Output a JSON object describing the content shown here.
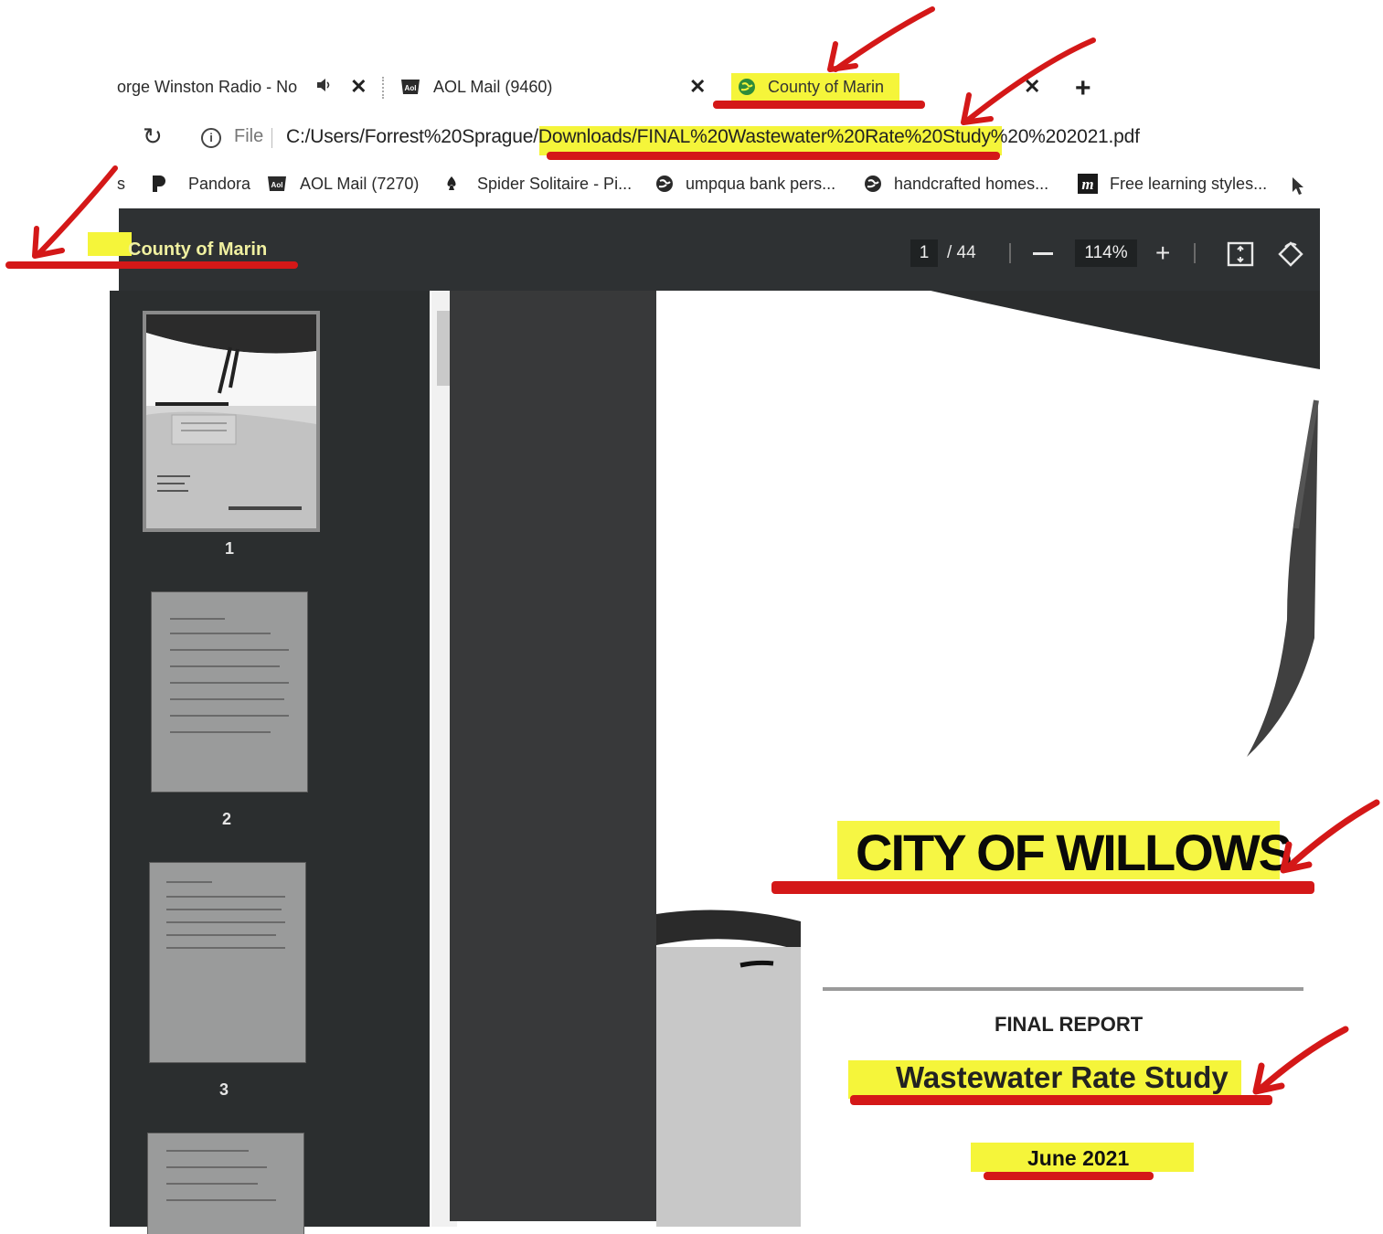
{
  "tabs": [
    {
      "title": "orge Winston Radio - No",
      "has_audio": true
    },
    {
      "title": "AOL Mail (9460)"
    },
    {
      "title": "County of Marin",
      "active": true
    }
  ],
  "address_bar": {
    "file_label": "File",
    "url": "C:/Users/Forrest%20Sprague/Downloads/FINAL%20Wastewater%20Rate%20Study%20%202021.pdf"
  },
  "bookmarks": [
    {
      "label": "s"
    },
    {
      "label": "Pandora",
      "icon": "pandora-icon"
    },
    {
      "label": "AOL Mail (7270)",
      "icon": "aol-icon"
    },
    {
      "label": "Spider Solitaire - Pi...",
      "icon": "spade-icon"
    },
    {
      "label": "umpqua bank pers...",
      "icon": "globe-icon"
    },
    {
      "label": "handcrafted homes...",
      "icon": "globe-icon"
    },
    {
      "label": "Free learning styles...",
      "icon": "m-icon"
    }
  ],
  "pdf": {
    "title": "County of Marin",
    "current_page": "1",
    "total_pages": "/ 44",
    "zoom": "114%",
    "thumbnails": [
      "1",
      "2",
      "3"
    ],
    "document": {
      "city": "CITY OF WILLOWS",
      "report": "FINAL REPORT",
      "study": "Wastewater Rate Study",
      "date": "June 2021"
    }
  },
  "colors": {
    "toolbar": "#2e3133",
    "sidebar": "#2b2e2f",
    "highlight": "#f5f53a",
    "annotation_red": "#d41818"
  }
}
